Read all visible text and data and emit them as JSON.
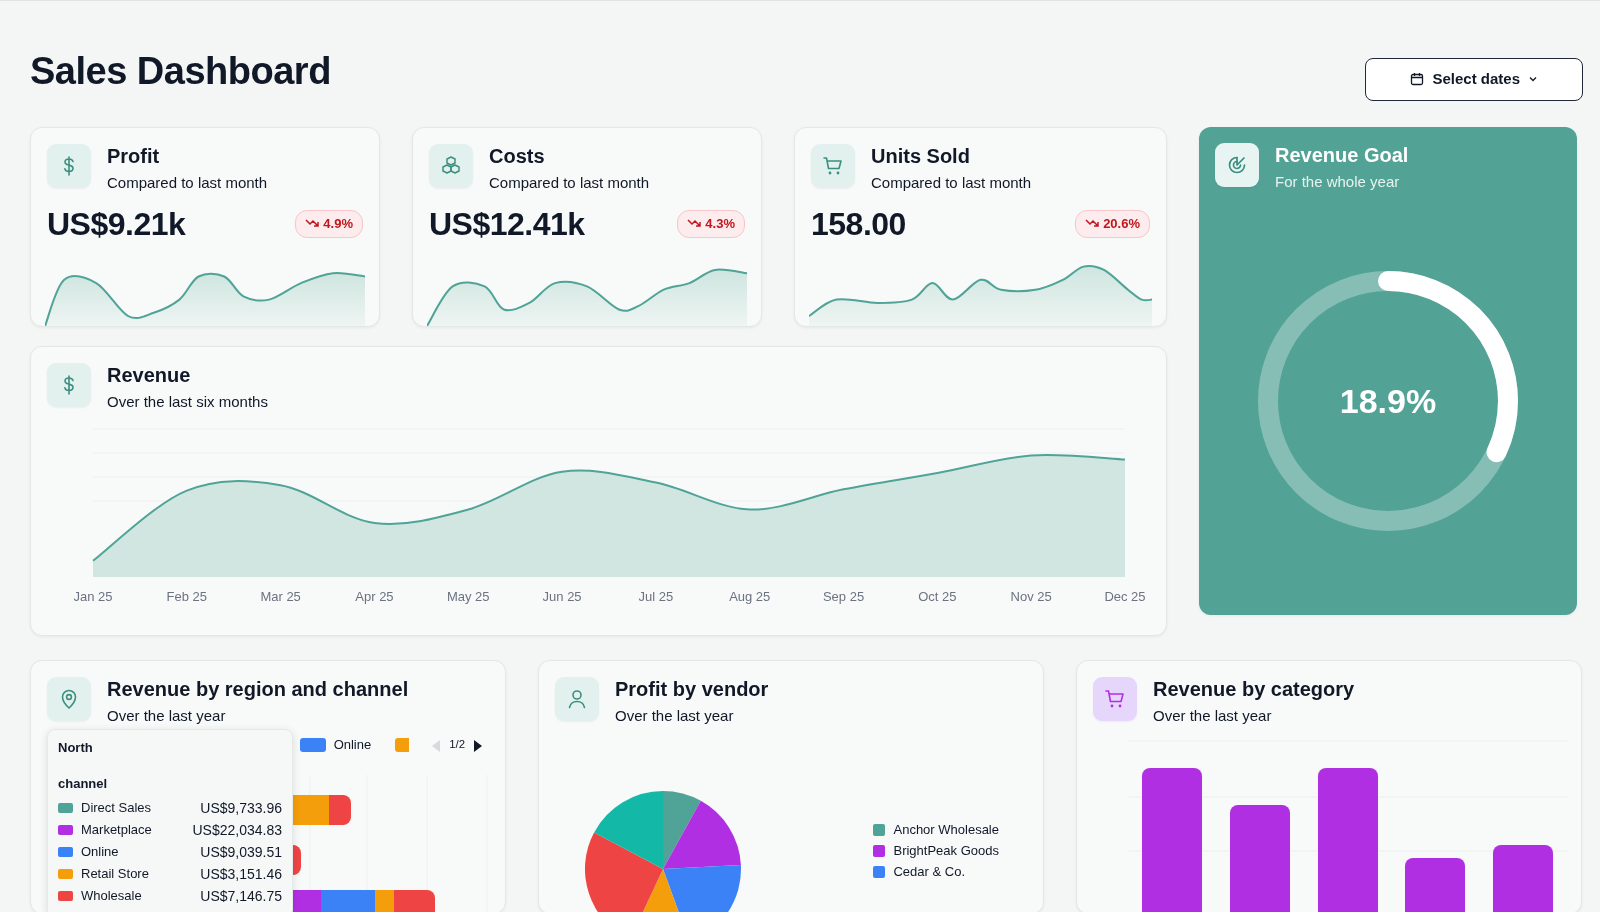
{
  "page": {
    "title": "Sales Dashboard"
  },
  "date_button": {
    "label": "Select dates"
  },
  "kpis": [
    {
      "title": "Profit",
      "subtitle": "Compared to last month",
      "value": "US$9.21k",
      "change": "4.9%",
      "falling": true
    },
    {
      "title": "Costs",
      "subtitle": "Compared to last month",
      "value": "US$12.41k",
      "change": "4.3%",
      "falling": true
    },
    {
      "title": "Units Sold",
      "subtitle": "Compared to last month",
      "value": "158.00",
      "change": "20.6%",
      "falling": true
    }
  ],
  "goal": {
    "title": "Revenue Goal",
    "subtitle": "For the whole year",
    "value": "18.9%",
    "level": 0.32
  },
  "revenue": {
    "title": "Revenue",
    "subtitle": "Over the last six months",
    "x_labels": [
      "Jan 25",
      "Feb 25",
      "Mar 25",
      "Apr 25",
      "May 25",
      "Jun 25",
      "Jul 25",
      "Aug 25",
      "Sep 25",
      "Oct 25",
      "Nov 25",
      "Dec 25"
    ]
  },
  "region": {
    "title": "Revenue by region and channel",
    "subtitle": "Over the last year",
    "legend": [
      {
        "label": "Online",
        "color": "#3b82f6"
      },
      {
        "color": "#f59e0b"
      }
    ],
    "pager": {
      "text": "1/2",
      "prev_disabled": true,
      "next_disabled": false
    },
    "tooltip": {
      "title": "North",
      "group": "channel",
      "rows": [
        {
          "label": "Direct Sales",
          "value": "US$9,733.96",
          "color": "#4fa397"
        },
        {
          "label": "Marketplace",
          "value": "US$22,034.83",
          "color": "#b12fe3"
        },
        {
          "label": "Online",
          "value": "US$9,039.51",
          "color": "#3b82f6"
        },
        {
          "label": "Retail Store",
          "value": "US$3,151.46",
          "color": "#f59e0b"
        },
        {
          "label": "Wholesale",
          "value": "US$7,146.75",
          "color": "#ef4444"
        }
      ]
    }
  },
  "vendor": {
    "title": "Profit by vendor",
    "subtitle": "Over the last year",
    "legend": [
      {
        "label": "Anchor Wholesale",
        "color": "#4fa397"
      },
      {
        "label": "BrightPeak Goods",
        "color": "#b12fe3"
      },
      {
        "label": "Cedar & Co.",
        "color": "#3b82f6"
      }
    ]
  },
  "category": {
    "title": "Revenue by category",
    "subtitle": "Over the last year"
  }
}
